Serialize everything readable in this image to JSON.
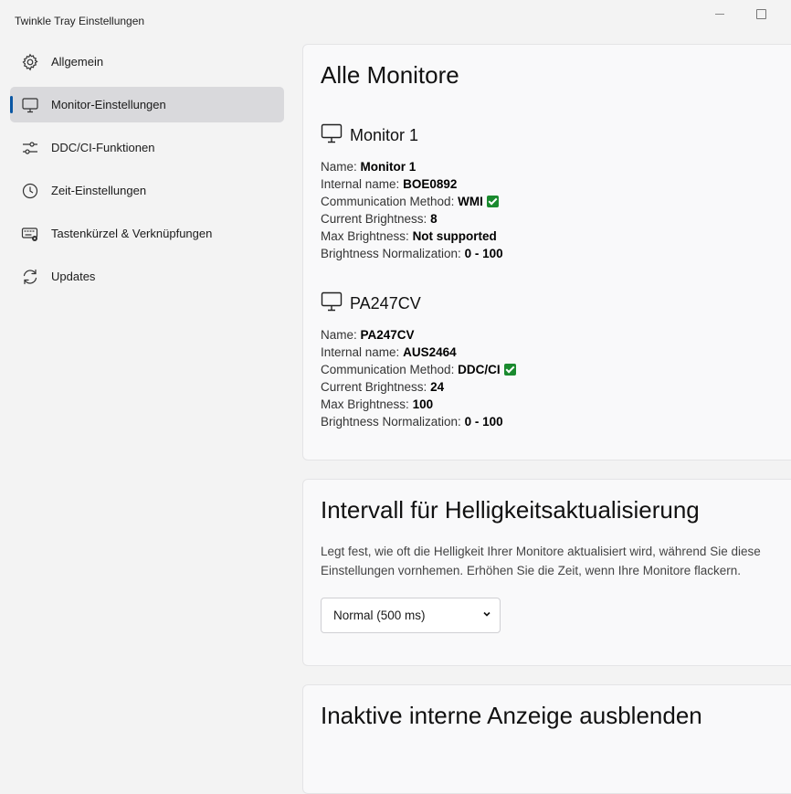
{
  "window": {
    "title": "Twinkle Tray Einstellungen"
  },
  "sidebar": {
    "items": [
      {
        "label": "Allgemein",
        "icon": "gear-icon"
      },
      {
        "label": "Monitor-Einstellungen",
        "icon": "monitor-icon",
        "active": true
      },
      {
        "label": "DDC/CI-Funktionen",
        "icon": "sliders-icon"
      },
      {
        "label": "Zeit-Einstellungen",
        "icon": "clock-icon"
      },
      {
        "label": "Tastenkürzel & Verknüpfungen",
        "icon": "keyboard-settings-icon"
      },
      {
        "label": "Updates",
        "icon": "refresh-icon"
      }
    ]
  },
  "all_monitors": {
    "title": "Alle Monitore",
    "labels": {
      "name": "Name:",
      "internal": "Internal name:",
      "method": "Communication Method:",
      "current": "Current Brightness:",
      "max": "Max Brightness:",
      "norm": "Brightness Normalization:"
    },
    "monitors": [
      {
        "heading": "Monitor 1",
        "name": "Monitor 1",
        "internal_name": "BOE0892",
        "method": "WMI",
        "current_brightness": "8",
        "max_brightness": "Not supported",
        "normalization": "0 - 100"
      },
      {
        "heading": "PA247CV",
        "name": "PA247CV",
        "internal_name": "AUS2464",
        "method": "DDC/CI",
        "current_brightness": "24",
        "max_brightness": "100",
        "normalization": "0 - 100"
      }
    ]
  },
  "interval": {
    "title": "Intervall für Helligkeitsaktualisierung",
    "description": "Legt fest, wie oft die Helligkeit Ihrer Monitore aktualisiert wird, während Sie diese Einstellungen vornhemen. Erhöhen Sie die Zeit, wenn Ihre Monitore flackern.",
    "selected": "Normal (500 ms)"
  },
  "inactive": {
    "title": "Inaktive interne Anzeige ausblenden"
  },
  "colors": {
    "accent": "#0b57a4",
    "check": "#1a8a2e",
    "active_bg": "#d9d9dc"
  }
}
